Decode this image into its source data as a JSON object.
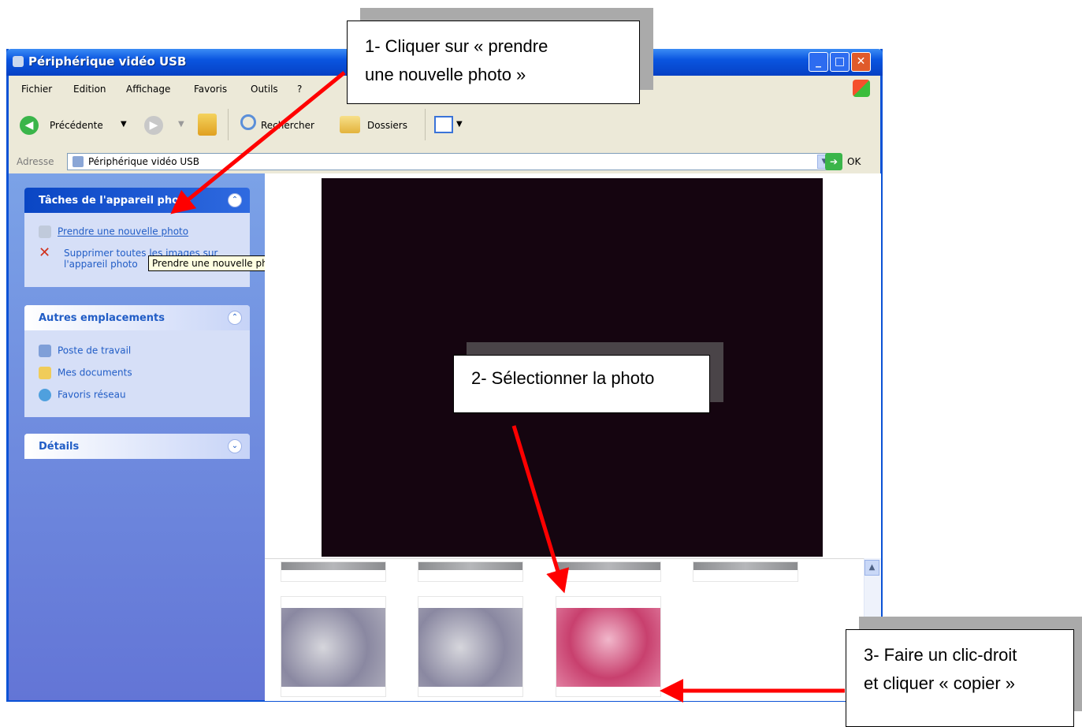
{
  "window": {
    "title": "Périphérique vidéo USB"
  },
  "menu": [
    "Fichier",
    "Edition",
    "Affichage",
    "Favoris",
    "Outils",
    "?"
  ],
  "toolbar": {
    "back": "Précédente",
    "search": "Rechercher",
    "folders": "Dossiers"
  },
  "address": {
    "label": "Adresse",
    "value": "Périphérique vidéo USB",
    "go": "OK"
  },
  "panels": {
    "tasks": {
      "title": "Tâches de l'appareil photo",
      "items": [
        "Prendre une nouvelle photo",
        "Supprimer toutes les images sur l'appareil photo"
      ]
    },
    "places": {
      "title": "Autres emplacements",
      "items": [
        "Poste de travail",
        "Mes documents",
        "Favoris réseau"
      ]
    },
    "details": {
      "title": "Détails"
    }
  },
  "tooltip": "Prendre une nouvelle photo",
  "callouts": {
    "c1_line1": "1- Cliquer sur « prendre",
    "c1_line2": "une nouvelle photo »",
    "c2": "2- Sélectionner la photo",
    "c3_line1": "3- Faire un clic-droit",
    "c3_line2": "et cliquer « copier »"
  },
  "colors": {
    "titlebar": "#0a55e0",
    "arrow": "#ff0000",
    "preview": "#150510"
  }
}
